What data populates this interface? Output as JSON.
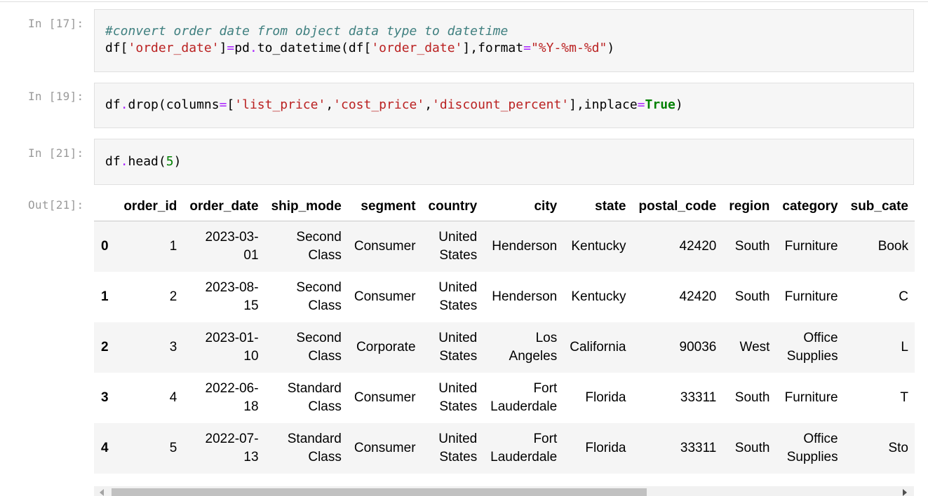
{
  "cells": [
    {
      "prompt": "In [17]:",
      "code": {
        "comment": "#convert order date from object data type to datetime",
        "line2": {
          "var": "df[",
          "str1": "'order_date'",
          "mid1": "]",
          "eq": "=",
          "func": "pd",
          "dot": ".",
          "call": "to_datetime(df[",
          "str2": "'order_date'",
          "mid2": "],format",
          "eq2": "=",
          "str3": "\"%Y-%m-%d\"",
          "close": ")"
        }
      }
    },
    {
      "prompt": "In [19]:",
      "code": {
        "obj": "df",
        "dot": ".",
        "call": "drop(columns",
        "eq": "=",
        "open": "[",
        "s1": "'list_price'",
        "c1": ",",
        "s2": "'cost_price'",
        "c2": ",",
        "s3": "'discount_percent'",
        "close": "],inplace",
        "eq2": "=",
        "kw": "True",
        "end": ")"
      }
    },
    {
      "prompt": "In [21]:",
      "code": {
        "obj": "df",
        "dot": ".",
        "call": "head(",
        "num": "5",
        "end": ")"
      }
    }
  ],
  "output": {
    "prompt": "Out[21]:",
    "columns": [
      "",
      "order_id",
      "order_date",
      "ship_mode",
      "segment",
      "country",
      "city",
      "state",
      "postal_code",
      "region",
      "category",
      "sub_cate"
    ],
    "rows": [
      [
        "0",
        "1",
        "2023-03-01",
        "Second Class",
        "Consumer",
        "United States",
        "Henderson",
        "Kentucky",
        "42420",
        "South",
        "Furniture",
        "Book"
      ],
      [
        "1",
        "2",
        "2023-08-15",
        "Second Class",
        "Consumer",
        "United States",
        "Henderson",
        "Kentucky",
        "42420",
        "South",
        "Furniture",
        "C"
      ],
      [
        "2",
        "3",
        "2023-01-10",
        "Second Class",
        "Corporate",
        "United States",
        "Los Angeles",
        "California",
        "90036",
        "West",
        "Office Supplies",
        "L"
      ],
      [
        "3",
        "4",
        "2022-06-18",
        "Standard Class",
        "Consumer",
        "United States",
        "Fort Lauderdale",
        "Florida",
        "33311",
        "South",
        "Furniture",
        "T"
      ],
      [
        "4",
        "5",
        "2022-07-13",
        "Standard Class",
        "Consumer",
        "United States",
        "Fort Lauderdale",
        "Florida",
        "33311",
        "South",
        "Office Supplies",
        "Sto"
      ]
    ],
    "display": {
      "order_date": [
        [
          "2023-03-",
          "01"
        ],
        [
          "2023-08-",
          "15"
        ],
        [
          "2023-01-",
          "10"
        ],
        [
          "2022-06-",
          "18"
        ],
        [
          "2022-07-",
          "13"
        ]
      ],
      "ship_mode": [
        [
          "Second",
          "Class"
        ],
        [
          "Second",
          "Class"
        ],
        [
          "Second",
          "Class"
        ],
        [
          "Standard",
          "Class"
        ],
        [
          "Standard",
          "Class"
        ]
      ],
      "country": [
        [
          "United",
          "States"
        ],
        [
          "United",
          "States"
        ],
        [
          "United",
          "States"
        ],
        [
          "United",
          "States"
        ],
        [
          "United",
          "States"
        ]
      ],
      "city": [
        [
          "Henderson"
        ],
        [
          "Henderson"
        ],
        [
          "Los",
          "Angeles"
        ],
        [
          "Fort",
          "Lauderdale"
        ],
        [
          "Fort",
          "Lauderdale"
        ]
      ],
      "category": [
        [
          "Furniture"
        ],
        [
          "Furniture"
        ],
        [
          "Office",
          "Supplies"
        ],
        [
          "Furniture"
        ],
        [
          "Office",
          "Supplies"
        ]
      ]
    }
  },
  "scrollbar": {
    "left_icon": "scroll-left-arrow-icon",
    "right_icon": "scroll-right-arrow-icon"
  }
}
